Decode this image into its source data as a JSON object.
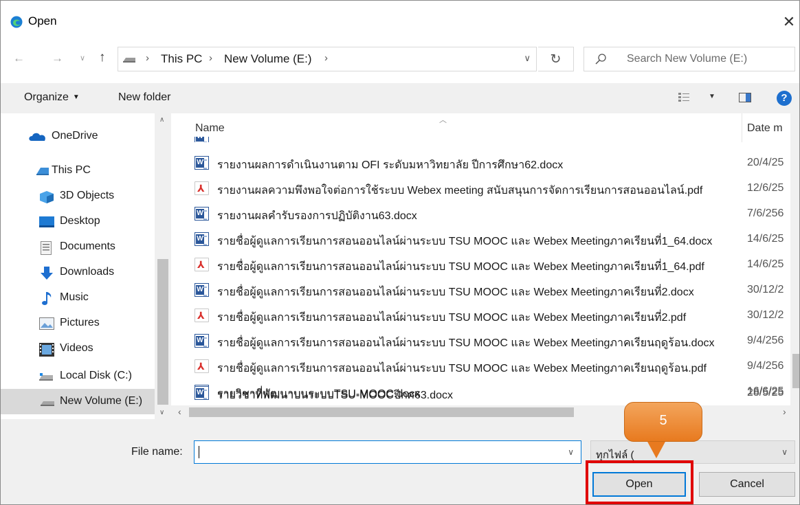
{
  "window": {
    "title": "Open",
    "close_glyph": "✕"
  },
  "address": {
    "crumbs": [
      "This PC",
      "New Volume (E:)"
    ],
    "search_placeholder": "Search New Volume (E:)"
  },
  "toolbar": {
    "organize_label": "Organize",
    "new_folder_label": "New folder",
    "help_glyph": "?"
  },
  "nav": {
    "items": [
      {
        "label": "OneDrive",
        "icon": "cloud-icon"
      },
      {
        "label": "This PC",
        "icon": "computer-icon"
      },
      {
        "label": "3D Objects",
        "icon": "cube-icon"
      },
      {
        "label": "Desktop",
        "icon": "desktop-icon"
      },
      {
        "label": "Documents",
        "icon": "document-icon"
      },
      {
        "label": "Downloads",
        "icon": "download-icon"
      },
      {
        "label": "Music",
        "icon": "music-icon"
      },
      {
        "label": "Pictures",
        "icon": "picture-icon"
      },
      {
        "label": "Videos",
        "icon": "video-icon"
      },
      {
        "label": "Local Disk (C:)",
        "icon": "disk-icon"
      },
      {
        "label": "New Volume (E:)",
        "icon": "drive-icon",
        "selected": true
      }
    ]
  },
  "columns": {
    "name": "Name",
    "date": "Date m"
  },
  "files": [
    {
      "name": "รายงานผลการดำเนินงานตาม OFI ระดับมหาวิทยาลัย ปีการศึกษา62.docx",
      "date": "20/4/25",
      "type": "word"
    },
    {
      "name": "รายงานผลความพึงพอใจต่อการใช้ระบบ Webex meeting สนับสนุนการจัดการเรียนการสอนออนไลน์.pdf",
      "date": "12/6/25",
      "type": "pdf"
    },
    {
      "name": "รายงานผลคำรับรองการปฏิบัติงาน63.docx",
      "date": "7/6/256",
      "type": "word"
    },
    {
      "name": "รายชื่อผู้ดูแลการเรียนการสอนออนไลน์ผ่านระบบ TSU MOOC และ Webex Meetingภาคเรียนที่1_64.docx",
      "date": "14/6/25",
      "type": "word"
    },
    {
      "name": "รายชื่อผู้ดูแลการเรียนการสอนออนไลน์ผ่านระบบ TSU MOOC และ Webex Meetingภาคเรียนที่1_64.pdf",
      "date": "14/6/25",
      "type": "pdf"
    },
    {
      "name": "รายชื่อผู้ดูแลการเรียนการสอนออนไลน์ผ่านระบบ TSU MOOC และ Webex Meetingภาคเรียนที่2.docx",
      "date": "30/12/2",
      "type": "word"
    },
    {
      "name": "รายชื่อผู้ดูแลการเรียนการสอนออนไลน์ผ่านระบบ TSU MOOC และ Webex Meetingภาคเรียนที่2.pdf",
      "date": "30/12/2",
      "type": "pdf"
    },
    {
      "name": "รายชื่อผู้ดูแลการเรียนการสอนออนไลน์ผ่านระบบ TSU MOOC และ Webex Meetingภาคเรียนฤดูร้อน.docx",
      "date": "9/4/256",
      "type": "word"
    },
    {
      "name": "รายชื่อผู้ดูแลการเรียนการสอนออนไลน์ผ่านระบบ TSU MOOC และ Webex Meetingภาคเรียนฤดูร้อน.pdf",
      "date": "9/4/256",
      "type": "pdf"
    },
    {
      "name": "รายวิชาที่พัฒนาบนระบบTSU-MOOC.docx",
      "date": "16/6/25",
      "type": "word"
    },
    {
      "name": "รายวิชาที่พัฒนาบนระบบTSU-MOOCปีกศ63.docx",
      "date": "28/5/25",
      "type": "word"
    }
  ],
  "bottom": {
    "file_name_label": "File name:",
    "file_name_value": "",
    "file_type_value": "ทุกไฟล์ (",
    "open_label": "Open",
    "cancel_label": "Cancel"
  },
  "annotation": {
    "step_number": "5"
  },
  "colors": {
    "accent": "#0078d7",
    "callout": "#e87a1f",
    "highlight": "#e00000"
  }
}
